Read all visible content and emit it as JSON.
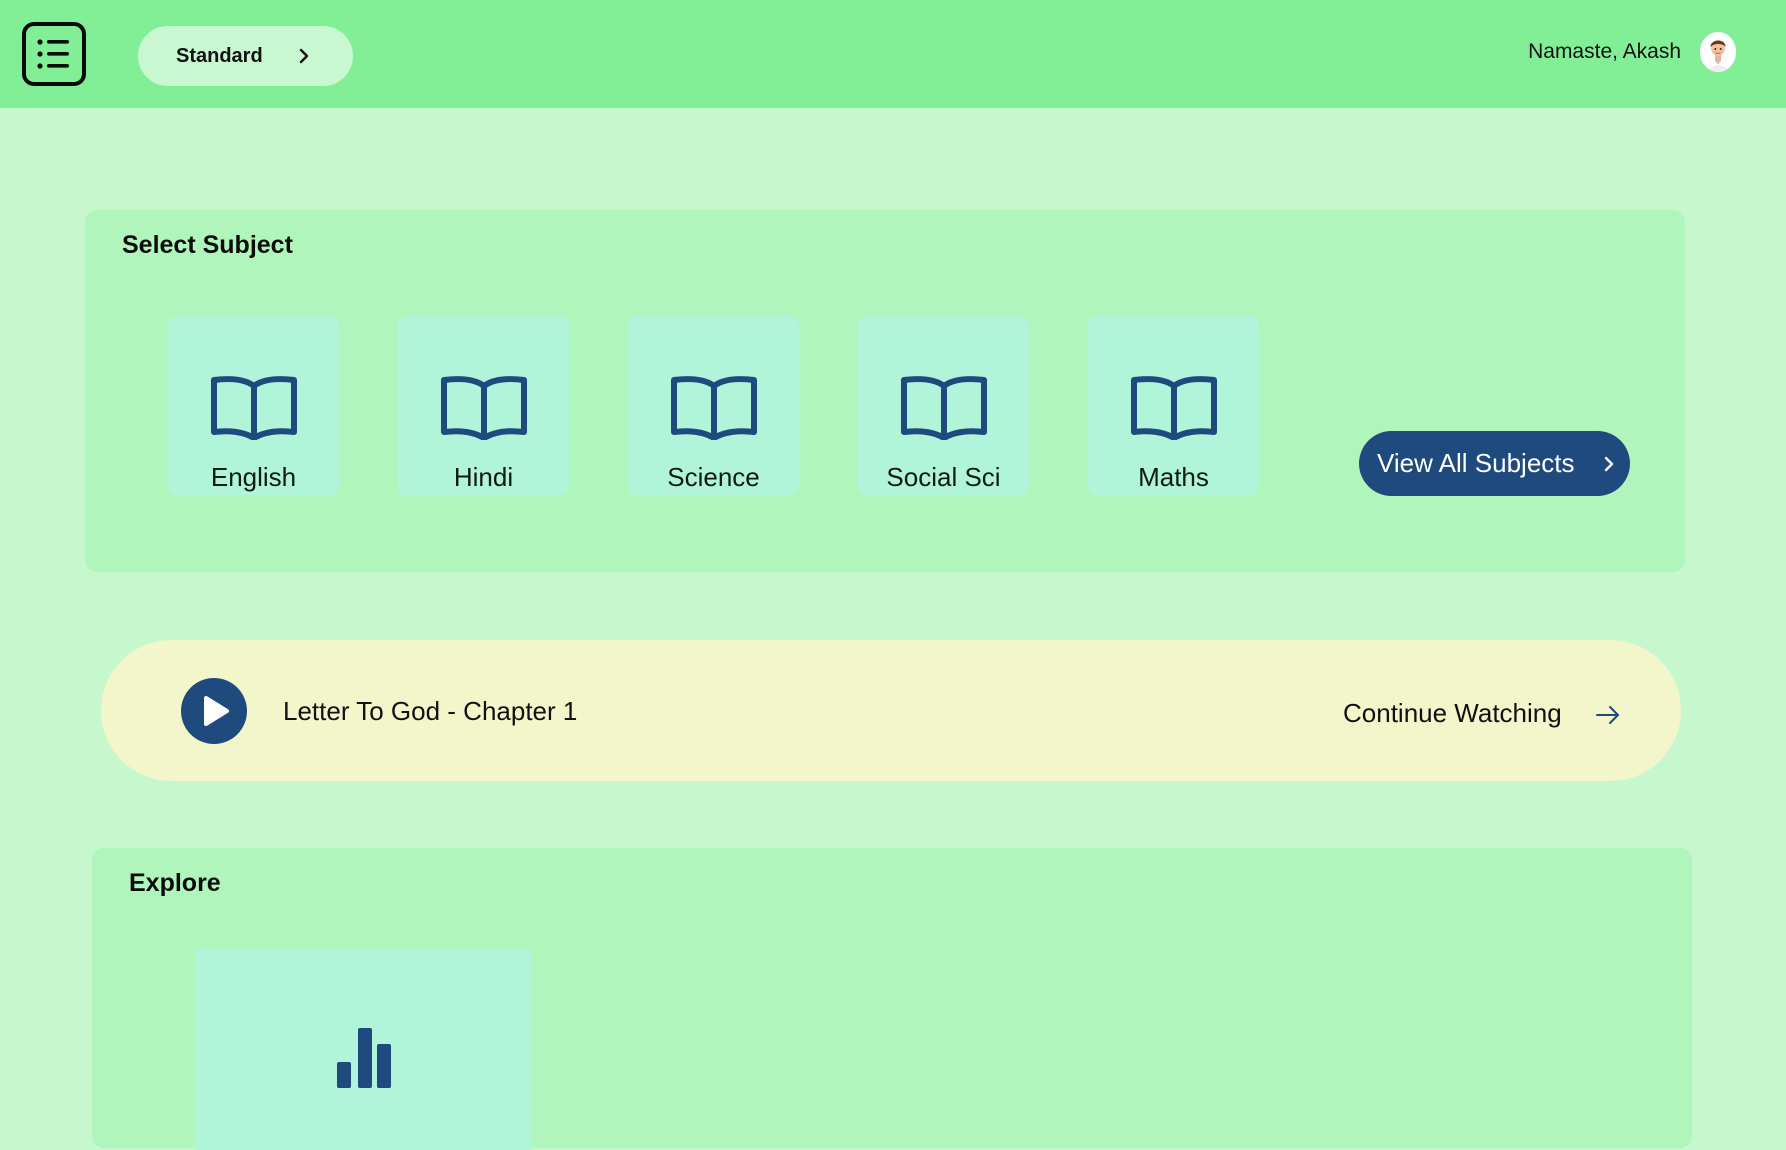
{
  "header": {
    "menu_icon": "list-menu-icon",
    "standard_label": "Standard",
    "greeting": "Namaste, Akash",
    "avatar_icon": "user-avatar"
  },
  "subjects": {
    "title": "Select Subject",
    "items": [
      {
        "label": "English",
        "icon": "open-book-icon"
      },
      {
        "label": "Hindi",
        "icon": "open-book-icon"
      },
      {
        "label": "Science",
        "icon": "open-book-icon"
      },
      {
        "label": "Social Sci",
        "icon": "open-book-icon"
      },
      {
        "label": "Maths",
        "icon": "open-book-icon"
      }
    ],
    "view_all_label": "View All Subjects"
  },
  "continue": {
    "lesson_title": "Letter To God - Chapter  1",
    "action_label": "Continue Watching"
  },
  "explore": {
    "title": "Explore",
    "card_icon": "bar-chart-icon"
  },
  "colors": {
    "page_bg": "#c7f8cd",
    "header_bg": "#82ef97",
    "panel_bg": "#b0f5bb",
    "card_bg": "#b0f5d9",
    "accent": "#1f4a7d",
    "continue_bg": "#f3f6cb"
  }
}
